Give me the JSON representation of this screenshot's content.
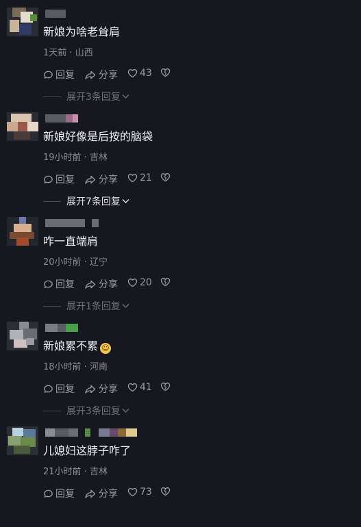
{
  "comments": [
    {
      "text": "新娘为啥老耸肩",
      "time": "1天前",
      "location": "山西",
      "emoji": "",
      "actions": {
        "reply": "回复",
        "share": "分享",
        "likes": "43"
      },
      "expand": "展开3条回复",
      "expand_state": "dim"
    },
    {
      "text": "新娘好像是后按的脑袋",
      "time": "19小时前",
      "location": "吉林",
      "emoji": "",
      "actions": {
        "reply": "回复",
        "share": "分享",
        "likes": "21"
      },
      "expand": "展开7条回复",
      "expand_state": "bright"
    },
    {
      "text": "咋一直端肩",
      "time": "20小时前",
      "location": "辽宁",
      "emoji": "",
      "actions": {
        "reply": "回复",
        "share": "分享",
        "likes": "20"
      },
      "expand": "展开1条回复",
      "expand_state": "dim"
    },
    {
      "text": "新娘累不累",
      "time": "18小时前",
      "location": "河南",
      "emoji": "grinning-face-emoji",
      "actions": {
        "reply": "回复",
        "share": "分享",
        "likes": "41"
      },
      "expand": "展开3条回复",
      "expand_state": "dim"
    },
    {
      "text": "儿媳妇这脖子咋了",
      "time": "21小时前",
      "location": "吉林",
      "emoji": "",
      "actions": {
        "reply": "回复",
        "share": "分享",
        "likes": "73"
      },
      "expand": "",
      "expand_state": "none"
    }
  ],
  "meta_separator": " · ",
  "icons": {
    "reply": "comment-bubble-icon",
    "share": "share-arrow-icon",
    "like": "heart-icon",
    "dislike": "broken-heart-icon",
    "expand": "chevron-down-icon"
  },
  "colors": {
    "background": "#16181f",
    "text_primary": "#eeeef0",
    "text_secondary": "#8c8e96",
    "text_dim": "#6f717a"
  }
}
